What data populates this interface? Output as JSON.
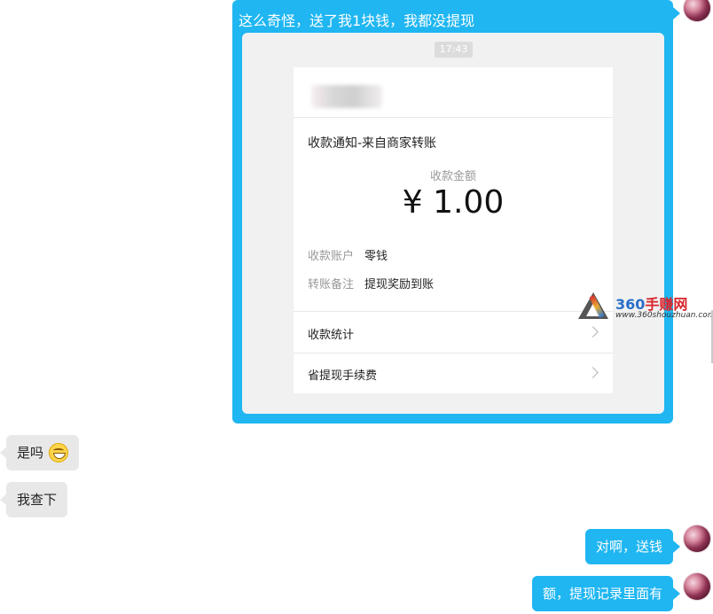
{
  "conversation": {
    "outgoing_main": {
      "text": "这么奇怪，送了我1块钱，我都没提现",
      "card_time": "17:43",
      "card": {
        "title": "收款通知-来自商家转账",
        "amount_label": "收款金额",
        "amount": "¥ 1.00",
        "rows": [
          {
            "label": "收款账户",
            "value": "零钱"
          },
          {
            "label": "转账备注",
            "value": "提现奖励到账"
          }
        ],
        "links": [
          {
            "label": "收款统计"
          },
          {
            "label": "省提现手续费"
          }
        ]
      }
    },
    "incoming": [
      {
        "text": "是吗",
        "emoji": "grinning-emoji"
      },
      {
        "text": "我查下"
      }
    ],
    "outgoing_followups": [
      {
        "text": "对啊，送钱"
      },
      {
        "text": "额，提现记录里面有"
      }
    ]
  },
  "watermark": {
    "brand_num": "360",
    "brand_text": "手赚网",
    "url": "www.360shouzhuan.com"
  },
  "colors": {
    "outgoing_bubble": "#1fb6f1",
    "incoming_bubble": "#e8e8e8",
    "card_background": "#f1f1f1"
  }
}
